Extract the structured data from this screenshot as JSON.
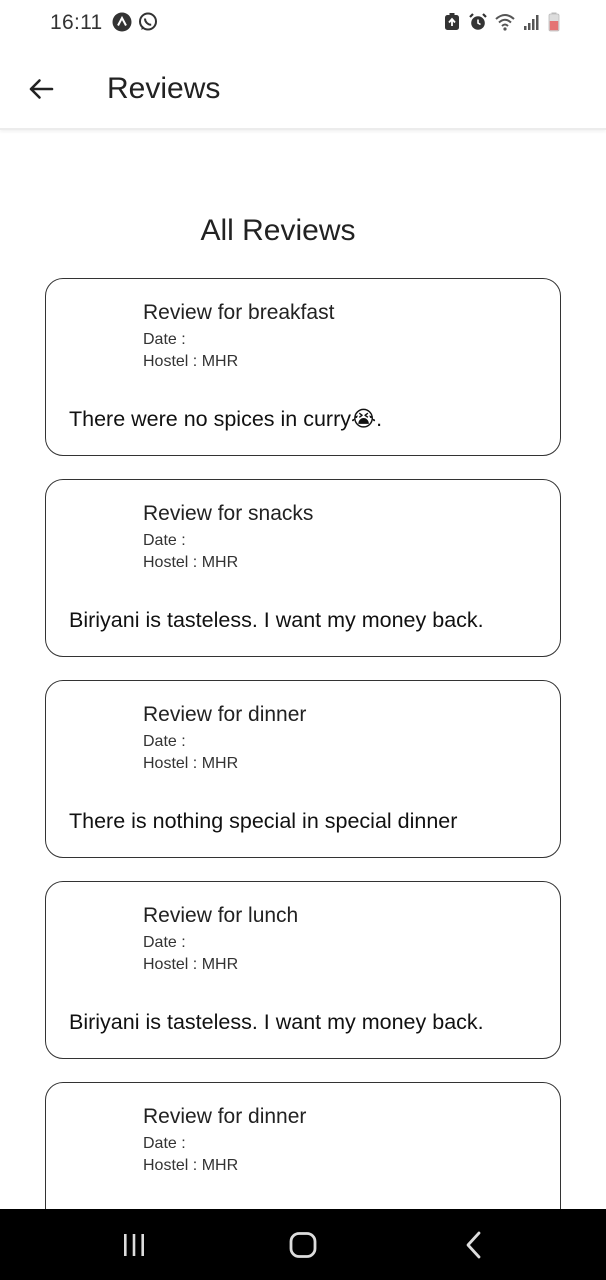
{
  "status_bar": {
    "time": "16:11",
    "left_icons": [
      "app-notification-icon",
      "whatsapp-icon"
    ],
    "right_icons": [
      "battery-saver-icon",
      "alarm-icon",
      "wifi-icon",
      "signal-icon",
      "battery-icon"
    ],
    "battery_color": "#e57373"
  },
  "app_bar": {
    "title": "Reviews",
    "back_icon": "arrow-back-icon"
  },
  "main": {
    "section_title": "All Reviews",
    "reviews": [
      {
        "title": "Review for breakfast",
        "date_label": "Date :",
        "date_value": "",
        "hostel_label": "Hostel :",
        "hostel_value": "MHR",
        "text": "There were no spices in curry😭."
      },
      {
        "title": "Review for snacks",
        "date_label": "Date :",
        "date_value": "",
        "hostel_label": "Hostel :",
        "hostel_value": "MHR",
        "text": "Biriyani is tasteless. I want my money back."
      },
      {
        "title": "Review for dinner",
        "date_label": "Date :",
        "date_value": "",
        "hostel_label": "Hostel :",
        "hostel_value": "MHR",
        "text": "There is nothing special in special dinner"
      },
      {
        "title": "Review for lunch",
        "date_label": "Date :",
        "date_value": "",
        "hostel_label": "Hostel :",
        "hostel_value": "MHR",
        "text": "Biriyani is tasteless. I want my money back."
      },
      {
        "title": "Review for dinner",
        "date_label": "Date :",
        "date_value": "",
        "hostel_label": "Hostel :",
        "hostel_value": "MHR",
        "text": ""
      }
    ]
  },
  "nav_bar": {
    "buttons": [
      "recent-apps-icon",
      "home-icon",
      "back-icon"
    ]
  }
}
